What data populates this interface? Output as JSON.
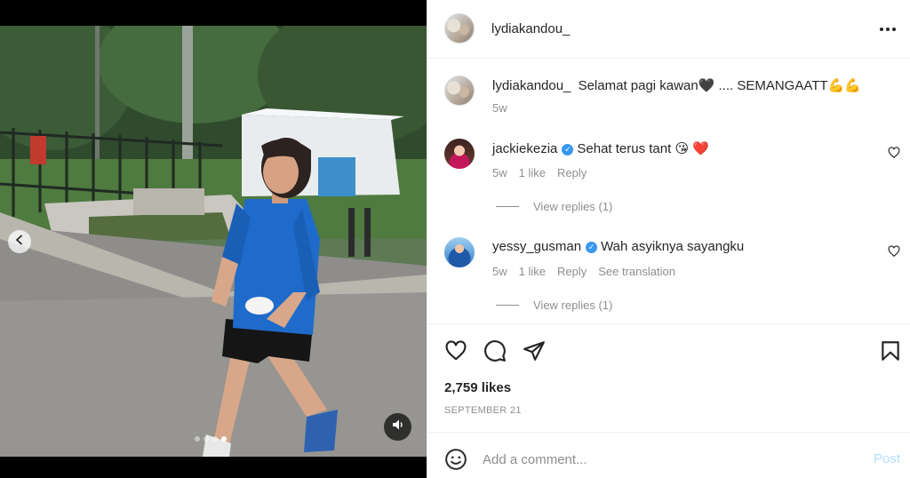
{
  "post": {
    "author": "lydiakandou_",
    "caption_username": "lydiakandou_",
    "caption_text": "Selamat pagi kawan🖤 .... SEMANGAATT💪💪",
    "caption_time": "5w"
  },
  "comments": [
    {
      "username": "jackiekezia",
      "verified": true,
      "text": "Sehat terus tant 😘 ❤️",
      "time": "5w",
      "likes": "1 like",
      "reply": "Reply",
      "view_replies": "View replies (1)"
    },
    {
      "username": "yessy_gusman",
      "verified": true,
      "text": "Wah asyiknya sayangku",
      "time": "5w",
      "likes": "1 like",
      "reply": "Reply",
      "translation": "See translation",
      "view_replies": "View replies (1)"
    }
  ],
  "stats": {
    "likes": "2,759 likes",
    "date": "SEPTEMBER 21"
  },
  "composer": {
    "placeholder": "Add a comment...",
    "post_label": "Post"
  },
  "carousel": {
    "count": 4,
    "active_index": 3
  },
  "icons": {
    "header_more": "more-horizontal-icon",
    "like": "heart-icon",
    "comment": "comment-bubble-icon",
    "share": "paper-plane-icon",
    "save": "bookmark-icon",
    "emoji": "smiley-icon",
    "mute": "volume-icon",
    "prev": "chevron-left-icon",
    "verified": "verified-badge-icon"
  },
  "colors": {
    "text": "#262626",
    "secondary": "#8e8e8e",
    "verified": "#3897f0",
    "post_disabled": "#b2dffc",
    "border": "#efefef"
  }
}
